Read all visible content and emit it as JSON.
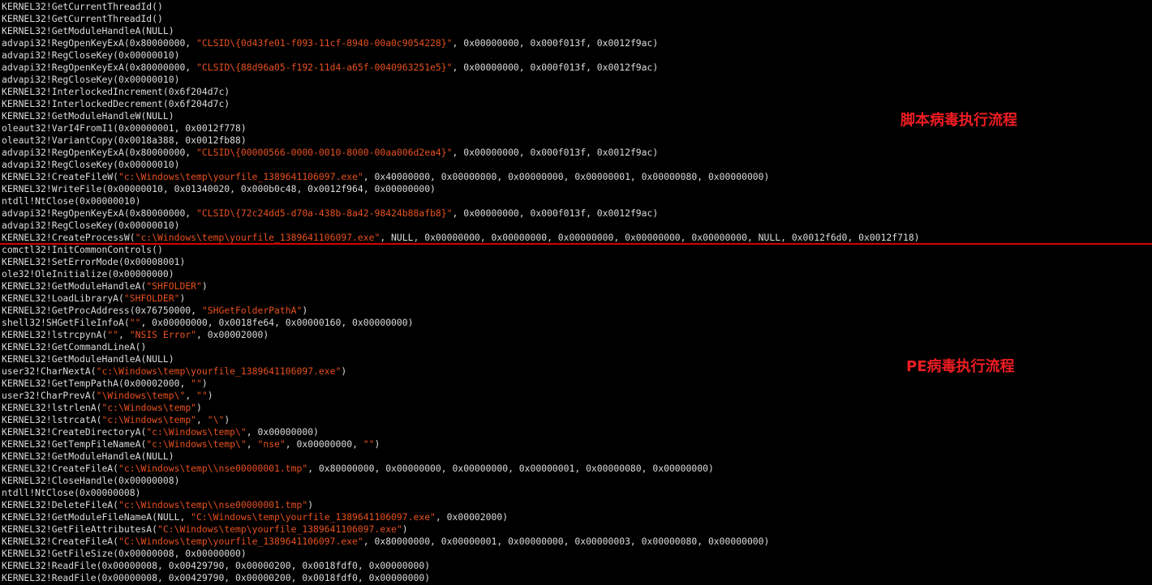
{
  "console": {
    "lines": [
      [
        [
          "KERNEL32!GetCurrentThreadId()",
          ""
        ]
      ],
      [
        [
          "KERNEL32!GetCurrentThreadId()",
          ""
        ]
      ],
      [
        [
          "KERNEL32!GetModuleHandleA(NULL)",
          ""
        ]
      ],
      [
        [
          "advapi32!RegOpenKeyExA(0x80000000, ",
          ""
        ],
        [
          "\"CLSID\\{0d43fe01-f093-11cf-8940-00a0c9054228}\"",
          "s"
        ],
        [
          ", 0x00000000, 0x000f013f, 0x0012f9ac)",
          ""
        ]
      ],
      [
        [
          "advapi32!RegCloseKey(0x00000010)",
          ""
        ]
      ],
      [
        [
          "advapi32!RegOpenKeyExA(0x80000000, ",
          ""
        ],
        [
          "\"CLSID\\{88d96a05-f192-11d4-a65f-0040963251e5}\"",
          "s"
        ],
        [
          ", 0x00000000, 0x000f013f, 0x0012f9ac)",
          ""
        ]
      ],
      [
        [
          "advapi32!RegCloseKey(0x00000010)",
          ""
        ]
      ],
      [
        [
          "KERNEL32!InterlockedIncrement(0x6f204d7c)",
          ""
        ]
      ],
      [
        [
          "KERNEL32!InterlockedDecrement(0x6f204d7c)",
          ""
        ]
      ],
      [
        [
          "KERNEL32!GetModuleHandleW(NULL)",
          ""
        ]
      ],
      [
        [
          "oleaut32!VarI4FromI1(0x00000001, 0x0012f778)",
          ""
        ]
      ],
      [
        [
          "oleaut32!VariantCopy(0x0018a388, 0x0012fb88)",
          ""
        ]
      ],
      [
        [
          "advapi32!RegOpenKeyExA(0x80000000, ",
          ""
        ],
        [
          "\"CLSID\\{00000566-0000-0010-8000-00aa006d2ea4}\"",
          "s"
        ],
        [
          ", 0x00000000, 0x000f013f, 0x0012f9ac)",
          ""
        ]
      ],
      [
        [
          "advapi32!RegCloseKey(0x00000010)",
          ""
        ]
      ],
      [
        [
          "KERNEL32!CreateFileW(",
          ""
        ],
        [
          "\"c:\\Windows\\temp\\yourfile_1389641106097.exe\"",
          "s"
        ],
        [
          ", 0x40000000, 0x00000000, 0x00000000, 0x00000001, 0x00000080, 0x00000000)",
          ""
        ]
      ],
      [
        [
          "KERNEL32!WriteFile(0x00000010, 0x01340020, 0x000b0c48, 0x0012f964, 0x00000000)",
          ""
        ]
      ],
      [
        [
          "ntdll!NtClose(0x00000010)",
          ""
        ]
      ],
      [
        [
          "advapi32!RegOpenKeyExA(0x80000000, ",
          ""
        ],
        [
          "\"CLSID\\{72c24dd5-d70a-438b-8a42-98424b88afb8}\"",
          "s"
        ],
        [
          ", 0x00000000, 0x000f013f, 0x0012f9ac)",
          ""
        ]
      ],
      [
        [
          "advapi32!RegCloseKey(0x00000010)",
          ""
        ]
      ],
      [
        [
          "KERNEL32!CreateProcessW(",
          ""
        ],
        [
          "\"c:\\Windows\\temp\\yourfile_1389641106097.exe\"",
          "s"
        ],
        [
          ", NULL, 0x00000000, 0x00000000, 0x00000000, 0x00000000, 0x00000000, NULL, 0x0012f6d0, 0x0012f718)",
          ""
        ]
      ],
      [
        [
          "comctl32!InitCommonControls()",
          ""
        ]
      ],
      [
        [
          "KERNEL32!SetErrorMode(0x00008001)",
          ""
        ]
      ],
      [
        [
          "ole32!OleInitialize(0x00000000)",
          ""
        ]
      ],
      [
        [
          "KERNEL32!GetModuleHandleA(",
          ""
        ],
        [
          "\"SHFOLDER\"",
          "s"
        ],
        [
          ")",
          ""
        ]
      ],
      [
        [
          "KERNEL32!LoadLibraryA(",
          ""
        ],
        [
          "\"SHFOLDER\"",
          "s"
        ],
        [
          ")",
          ""
        ]
      ],
      [
        [
          "KERNEL32!GetProcAddress(0x76750000, ",
          ""
        ],
        [
          "\"SHGetFolderPathA\"",
          "s"
        ],
        [
          ")",
          ""
        ]
      ],
      [
        [
          "shell32!SHGetFileInfoA(",
          ""
        ],
        [
          "\"\"",
          "s"
        ],
        [
          ", 0x00000000, 0x0018fe64, 0x00000160, 0x00000000)",
          ""
        ]
      ],
      [
        [
          "KERNEL32!lstrcpynA(",
          ""
        ],
        [
          "\"\"",
          "s"
        ],
        [
          ", ",
          ""
        ],
        [
          "\"NSIS Error\"",
          "s"
        ],
        [
          ", 0x00002000)",
          ""
        ]
      ],
      [
        [
          "KERNEL32!GetCommandLineA()",
          ""
        ]
      ],
      [
        [
          "KERNEL32!GetModuleHandleA(NULL)",
          ""
        ]
      ],
      [
        [
          "user32!CharNextA(",
          ""
        ],
        [
          "\"c:\\Windows\\temp\\yourfile_1389641106097.exe\"",
          "s"
        ],
        [
          ")",
          ""
        ]
      ],
      [
        [
          "KERNEL32!GetTempPathA(0x00002000, ",
          ""
        ],
        [
          "\"\"",
          "s"
        ],
        [
          ")",
          ""
        ]
      ],
      [
        [
          "user32!CharPrevA(",
          ""
        ],
        [
          "\"\\Windows\\temp\\\"",
          "s"
        ],
        [
          ", ",
          ""
        ],
        [
          "\"\"",
          "s"
        ],
        [
          ")",
          ""
        ]
      ],
      [
        [
          "KERNEL32!lstrlenA(",
          ""
        ],
        [
          "\"c:\\Windows\\temp\"",
          "s"
        ],
        [
          ")",
          ""
        ]
      ],
      [
        [
          "KERNEL32!lstrcatA(",
          ""
        ],
        [
          "\"c:\\Windows\\temp\"",
          "s"
        ],
        [
          ", ",
          ""
        ],
        [
          "\"\\\"",
          "s"
        ],
        [
          ")",
          ""
        ]
      ],
      [
        [
          "KERNEL32!CreateDirectoryA(",
          ""
        ],
        [
          "\"c:\\Windows\\temp\\\"",
          "s"
        ],
        [
          ", 0x00000000)",
          ""
        ]
      ],
      [
        [
          "KERNEL32!GetTempFileNameA(",
          ""
        ],
        [
          "\"c:\\Windows\\temp\\\"",
          "s"
        ],
        [
          ", ",
          ""
        ],
        [
          "\"nse\"",
          "s"
        ],
        [
          ", 0x00000000, ",
          ""
        ],
        [
          "\"\"",
          "s"
        ],
        [
          ")",
          ""
        ]
      ],
      [
        [
          "KERNEL32!GetModuleHandleA(NULL)",
          ""
        ]
      ],
      [
        [
          "KERNEL32!CreateFileA(",
          ""
        ],
        [
          "\"c:\\Windows\\temp\\\\nse00000001.tmp\"",
          "s"
        ],
        [
          ", 0x80000000, 0x00000000, 0x00000000, 0x00000001, 0x00000080, 0x00000000)",
          ""
        ]
      ],
      [
        [
          "KERNEL32!CloseHandle(0x00000008)",
          ""
        ]
      ],
      [
        [
          "ntdll!NtClose(0x00000008)",
          ""
        ]
      ],
      [
        [
          "KERNEL32!DeleteFileA(",
          ""
        ],
        [
          "\"c:\\Windows\\temp\\\\nse00000001.tmp\"",
          "s"
        ],
        [
          ")",
          ""
        ]
      ],
      [
        [
          "KERNEL32!GetModuleFileNameA(NULL, ",
          ""
        ],
        [
          "\"C:\\Windows\\temp\\yourfile_1389641106097.exe\"",
          "s"
        ],
        [
          ", 0x00002000)",
          ""
        ]
      ],
      [
        [
          "KERNEL32!GetFileAttributesA(",
          ""
        ],
        [
          "\"C:\\Windows\\temp\\yourfile_1389641106097.exe\"",
          "s"
        ],
        [
          ")",
          ""
        ]
      ],
      [
        [
          "KERNEL32!CreateFileA(",
          ""
        ],
        [
          "\"C:\\Windows\\temp\\yourfile_1389641106097.exe\"",
          "s"
        ],
        [
          ", 0x80000000, 0x00000001, 0x00000000, 0x00000003, 0x00000080, 0x00000000)",
          ""
        ]
      ],
      [
        [
          "KERNEL32!GetFileSize(0x00000008, 0x00000000)",
          ""
        ]
      ],
      [
        [
          "KERNEL32!ReadFile(0x00000008, 0x00429790, 0x00000200, 0x0018fdf0, 0x00000000)",
          ""
        ]
      ],
      [
        [
          "KERNEL32!ReadFile(0x00000008, 0x00429790, 0x00000200, 0x0018fdf0, 0x00000000)",
          ""
        ]
      ]
    ]
  },
  "annotations": {
    "script_flow": "脚本病毒执行流程",
    "pe_flow": "PE病毒执行流程"
  },
  "colors": {
    "background": "#000000",
    "text": "#dcdcdc",
    "string": "#e8501e",
    "annotation": "#ee1d23",
    "divider": "#d40000"
  }
}
